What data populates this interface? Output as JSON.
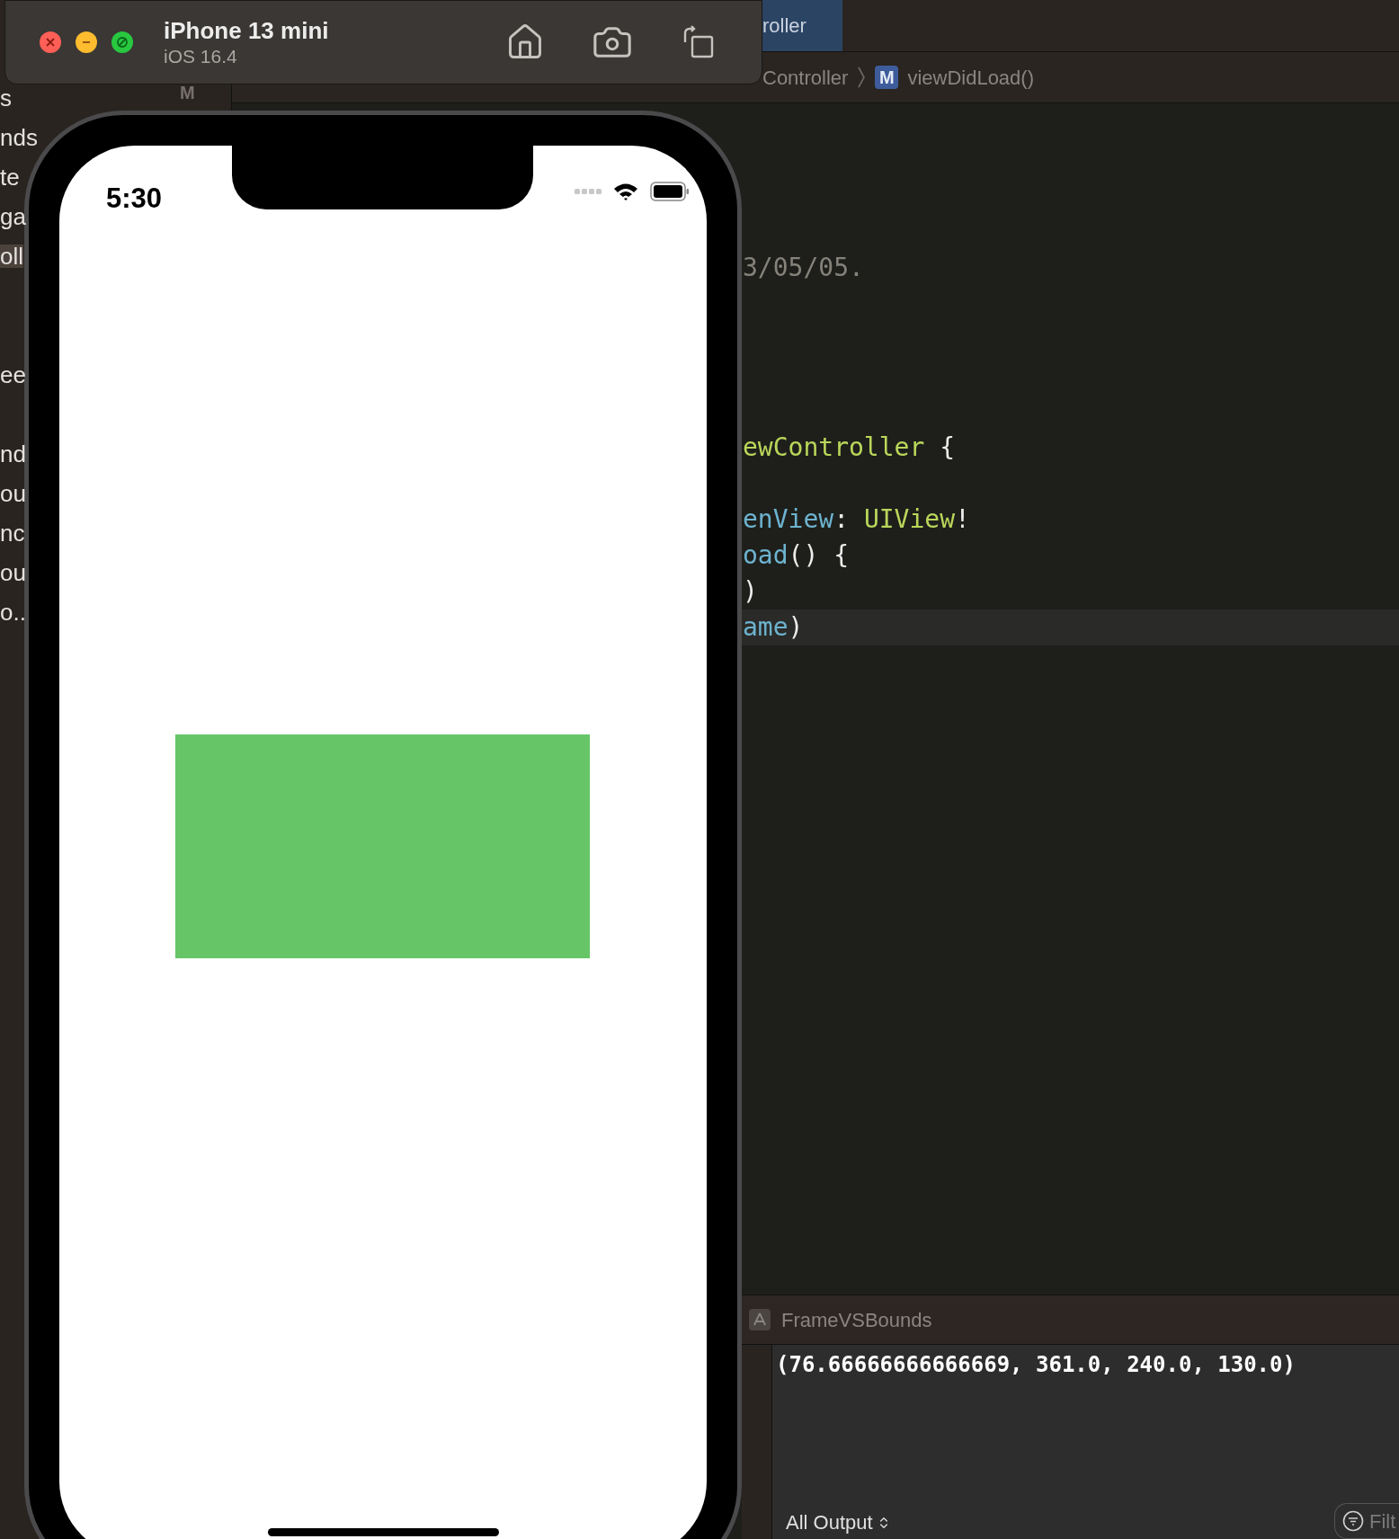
{
  "simulator": {
    "device": "iPhone 13 mini",
    "os": "iOS 16.4"
  },
  "phone": {
    "time": "5:30"
  },
  "xcode": {
    "tab": {
      "label": "roller",
      "selected": true
    },
    "breadcrumb": {
      "item": "Controller",
      "method_badge": "M",
      "method": "viewDidLoad()"
    },
    "sidebar": {
      "badge": "M",
      "items": [
        {
          "label": "s",
          "selected": false
        },
        {
          "label": "nds",
          "selected": false
        },
        {
          "label": "te",
          "selected": false
        },
        {
          "label": "ga",
          "selected": false
        },
        {
          "label": "oll",
          "selected": true
        },
        {
          "label": "ee",
          "selected": false
        },
        {
          "label": "nd",
          "selected": false
        },
        {
          "label": "ou",
          "selected": false
        },
        {
          "label": "nc",
          "selected": false
        },
        {
          "label": "ou",
          "selected": false
        },
        {
          "label": "o..",
          "selected": false
        }
      ]
    },
    "code_lines": [
      {
        "highlighted": false,
        "tokens": [
          {
            "text": "3/05/05.",
            "kind": "comment"
          }
        ]
      },
      {
        "highlighted": false
      },
      {
        "highlighted": false
      },
      {
        "highlighted": false
      },
      {
        "highlighted": false
      },
      {
        "highlighted": false,
        "tokens": [
          {
            "text": "ewController",
            "kind": "type"
          },
          {
            "text": " {",
            "kind": "plain"
          }
        ]
      },
      {
        "highlighted": false
      },
      {
        "highlighted": false,
        "tokens": [
          {
            "text": "enView",
            "kind": "property"
          },
          {
            "text": ": ",
            "kind": "plain"
          },
          {
            "text": "UIView",
            "kind": "type"
          },
          {
            "text": "!",
            "kind": "plain"
          }
        ]
      },
      {
        "highlighted": false,
        "tokens": [
          {
            "text": "oad",
            "kind": "property"
          },
          {
            "text": "() {",
            "kind": "plain"
          }
        ]
      },
      {
        "highlighted": false,
        "tokens": [
          {
            "text": ")",
            "kind": "plain"
          }
        ]
      },
      {
        "highlighted": true,
        "tokens": [
          {
            "text": "ame",
            "kind": "property"
          },
          {
            "text": ")",
            "kind": "plain"
          }
        ]
      }
    ],
    "console": {
      "target": "FrameVSBounds",
      "output": "(76.66666666666669, 361.0, 240.0, 130.0)",
      "filter_menu": "All Output",
      "filter_placeholder": "Filt"
    }
  }
}
